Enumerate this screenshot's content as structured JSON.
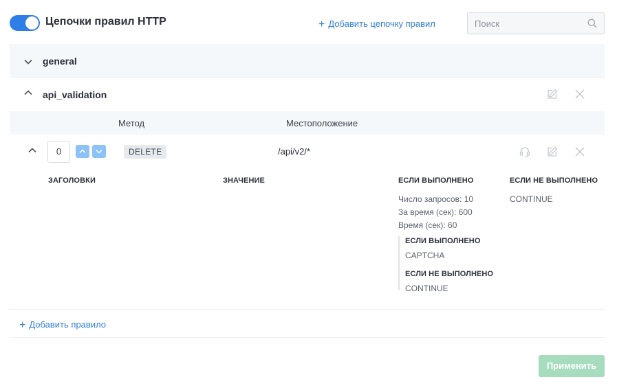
{
  "header": {
    "title": "Цепочки правил HTTP",
    "toggle_on": true,
    "add_chain_label": "Добавить цепочку правил",
    "search_placeholder": "Поиск"
  },
  "chains": [
    {
      "name": "general",
      "expanded": false
    },
    {
      "name": "api_validation",
      "expanded": true
    }
  ],
  "columns": {
    "method": "Метод",
    "location": "Местоположение"
  },
  "rule": {
    "order": "0",
    "method": "DELETE",
    "location": "/api/v2/*"
  },
  "details": {
    "headers_label": "ЗАГОЛОВКИ",
    "value_label": "ЗНАЧЕНИЕ",
    "if_met_label": "ЕСЛИ ВЫПОЛНЕНО",
    "if_not_met_label": "ЕСЛИ НЕ ВЫПОЛНЕНО",
    "if_not_met_value": "CONTINUE",
    "conditions": [
      "Число запросов: 10",
      "За время (сек): 600",
      "Время (сек): 60"
    ],
    "nested": {
      "if_met_label": "ЕСЛИ ВЫПОЛНЕНО",
      "if_met_value": "CAPTCHA",
      "if_not_met_label": "ЕСЛИ НЕ ВЫПОЛНЕНО",
      "if_not_met_value": "CONTINUE"
    }
  },
  "add_rule_label": "Добавить правило",
  "apply_label": "Применить",
  "colors": {
    "accent": "#2f7ee8",
    "arrow_button": "#8cc2f7",
    "apply_disabled": "#a7dcbe",
    "row_tint": "#f5f8fb"
  }
}
